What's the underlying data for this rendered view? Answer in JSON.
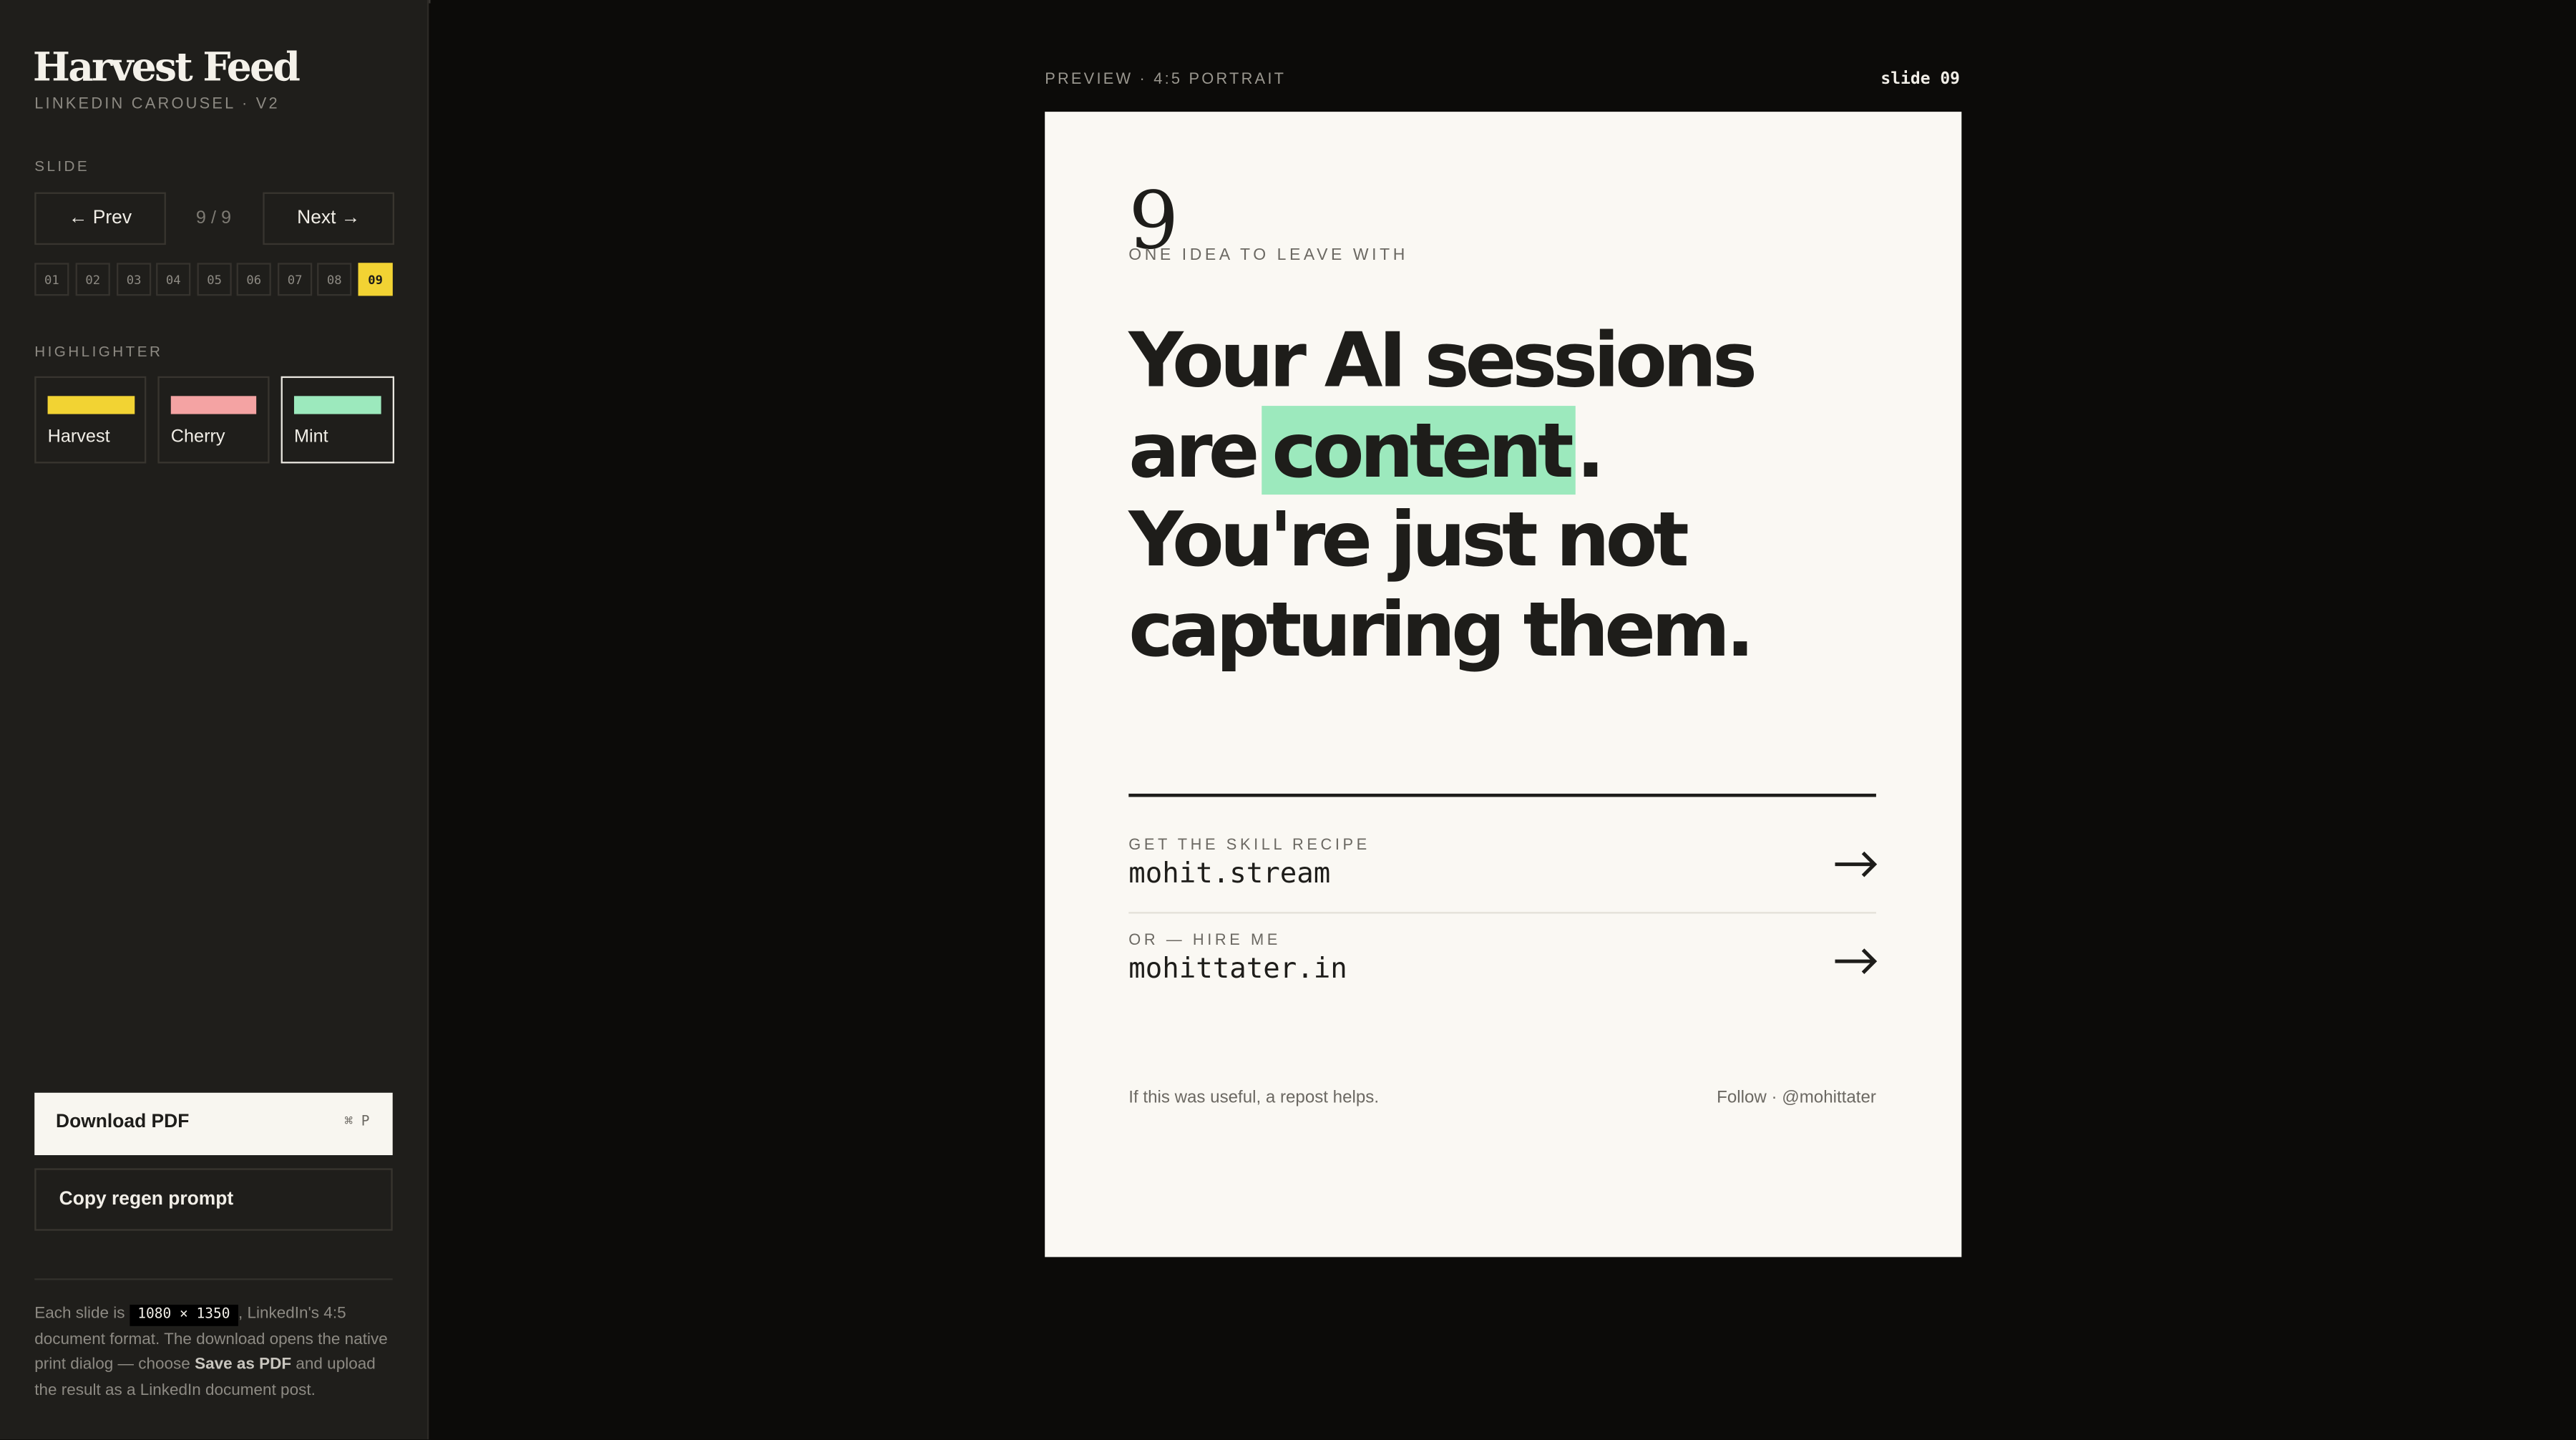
{
  "brand": {
    "title": "Harvest Feed",
    "subtitle": "LINKEDIN CAROUSEL · V2"
  },
  "slide_nav": {
    "label": "SLIDE",
    "prev": "← Prev",
    "next": "Next →",
    "counter": "9 / 9",
    "chips": [
      "01",
      "02",
      "03",
      "04",
      "05",
      "06",
      "07",
      "08",
      "09"
    ],
    "active_index": 8
  },
  "highlighter": {
    "label": "HIGHLIGHTER",
    "options": [
      {
        "name": "Harvest",
        "color": "#f2d333"
      },
      {
        "name": "Cherry",
        "color": "#f4a3a3"
      },
      {
        "name": "Mint",
        "color": "#9ce9bd"
      }
    ],
    "selected": "Mint"
  },
  "actions": {
    "download": "Download PDF",
    "download_shortcut": "⌘ P",
    "copy": "Copy regen prompt"
  },
  "note": {
    "pre": "Each slide is",
    "code": "1080 × 1350",
    "mid": ", LinkedIn's 4:5 document format. The download opens the native print dialog — choose",
    "bold": "Save as PDF",
    "post": "and upload the result as a LinkedIn document post."
  },
  "preview": {
    "label": "PREVIEW · 4:5 PORTRAIT",
    "slide_label": "slide 09"
  },
  "slide": {
    "number": "9",
    "kicker": "ONE IDEA TO LEAVE WITH",
    "headline_line1": "Your AI sessions",
    "headline_are": "are",
    "headline_highlight": "content",
    "headline_period": ".",
    "headline_line3": "You're just not",
    "headline_line4": "capturing them.",
    "cta1_small": "GET THE SKILL RECIPE",
    "cta1_big": "mohit.stream",
    "cta2_small": "OR — HIRE ME",
    "cta2_big": "mohittater.in",
    "footer_left": "If this was useful, a repost helps.",
    "footer_right": "Follow · @mohittater"
  }
}
